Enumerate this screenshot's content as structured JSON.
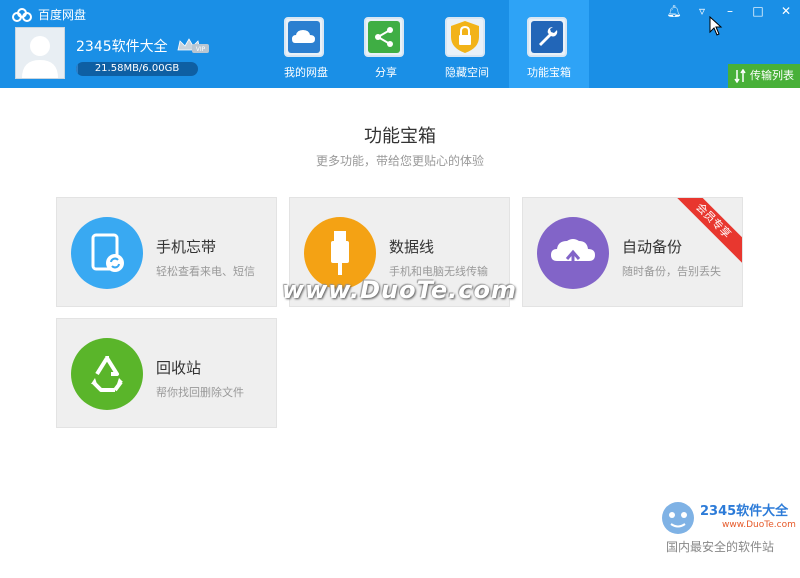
{
  "app": {
    "title": "百度网盘"
  },
  "user": {
    "name": "2345软件大全",
    "vip_label": "VIP",
    "quota_text": "21.58MB/6.00GB",
    "quota_used_fraction": 0.0035
  },
  "nav": {
    "tabs": [
      {
        "label": "我的网盘",
        "icon": "cloud-icon",
        "active": false
      },
      {
        "label": "分享",
        "icon": "share-icon",
        "active": false
      },
      {
        "label": "隐藏空间",
        "icon": "lock-icon",
        "active": false
      },
      {
        "label": "功能宝箱",
        "icon": "wrench-icon",
        "active": true
      }
    ]
  },
  "window_controls": [
    "bell-icon",
    "dropdown-icon",
    "minimize-icon",
    "maximize-icon",
    "close-icon"
  ],
  "transfer": {
    "label": "传输列表"
  },
  "main": {
    "title": "功能宝箱",
    "subtitle": "更多功能，带给您更贴心的体验",
    "cards": [
      {
        "title": "手机忘带",
        "desc": "轻松查看来电、短信",
        "icon": "phone-sync-icon",
        "color": "#39a9f2"
      },
      {
        "title": "数据线",
        "desc": "手机和电脑无线传输",
        "icon": "usb-cable-icon",
        "color": "#f4a214"
      },
      {
        "title": "自动备份",
        "desc": "随时备份，告别丢失",
        "icon": "cloud-upload-icon",
        "color": "#8264c8",
        "ribbon": "会员专享"
      },
      {
        "title": "回收站",
        "desc": "帮你找回删除文件",
        "icon": "recycle-icon",
        "color": "#5ab52a"
      }
    ]
  },
  "watermark": {
    "center": "www.DuoTe.com",
    "logo_title": "2345软件大全",
    "logo_url": "www.DuoTe.com",
    "slogan": "国内最安全的软件站"
  },
  "colors": {
    "header_bg": "#1a8fe6",
    "active_tab": "#2ea3f6",
    "transfer_btn": "#48b038",
    "ribbon": "#e8372f"
  }
}
